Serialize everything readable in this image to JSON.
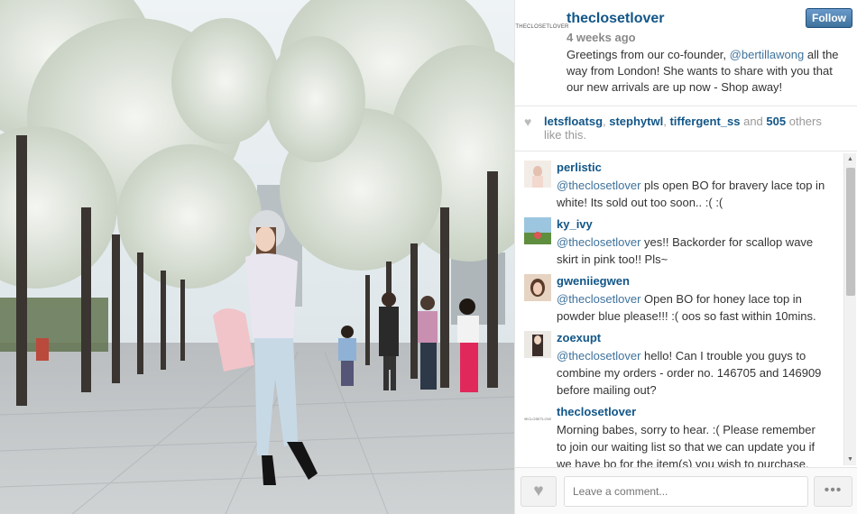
{
  "post": {
    "username": "theclosetlover",
    "logo_text": "THECLOSETLOVER",
    "time": "4 weeks ago",
    "follow_label": "Follow",
    "caption_pre": "Greetings from our co-founder, ",
    "caption_mention": "@bertillawong",
    "caption_post": " all the way from London! She wants to share with you that our new arrivals are up now - Shop away!"
  },
  "likes": {
    "icon": "heart-icon",
    "user1": "letsfloatsg",
    "user2": "stephytwl",
    "user3": "tiffergent_ss",
    "and_text": " and ",
    "count": "505",
    "others_text": " others like this."
  },
  "comments": [
    {
      "name": "perlistic",
      "mention": "@theclosetlover",
      "text": " pls open BO for bravery lace top in white! Its sold out too soon.. :( :("
    },
    {
      "name": "ky_ivy",
      "mention": "@theclosetlover",
      "text": " yes!! Backorder for scallop wave skirt in pink too!! Pls~"
    },
    {
      "name": "gweniiegwen",
      "mention": "@theclosetlover",
      "text": " Open BO for honey lace top in powder blue please!!! :( oos so fast within 10mins."
    },
    {
      "name": "zoexupt",
      "mention": "@theclosetlover",
      "text": " hello! Can I trouble you guys to combine my orders - order no. 146705 and 146909 before mailing out?"
    },
    {
      "name": "theclosetlover",
      "logo_text": "THECLOSETLOVER",
      "mention": "",
      "text": "Morning babes, sorry to hear. :( Please remember to join our waiting list so that we can update you if we have bo for the item(s) you wish to purchase. Thank you!"
    }
  ],
  "footer": {
    "comment_placeholder": "Leave a comment...",
    "more_label": "•••",
    "like_icon": "heart-icon"
  },
  "colors": {
    "link": "#125688",
    "mention": "#3f729b",
    "follow": "#3f729b"
  }
}
